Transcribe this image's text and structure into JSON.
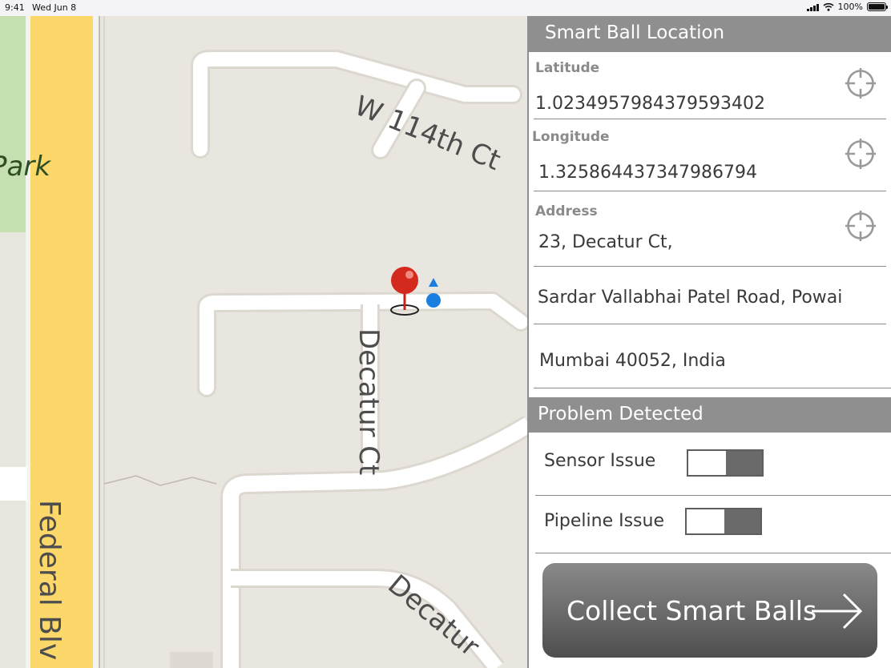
{
  "status_bar": {
    "time": "9:41",
    "date": "Wed Jun 8",
    "battery": "100%"
  },
  "map": {
    "labels": {
      "park": "Park",
      "w114": "W 114th Ct",
      "decatur_ct": "Decatur Ct",
      "decatur_lower": "Decatur",
      "federal": "Federal Blv"
    }
  },
  "location": {
    "header": "Smart Ball Location",
    "latitude_label": "Latitude",
    "latitude_value": "1.0234957984379593402",
    "longitude_label": "Longitude",
    "longitude_value": "1.325864437347986794",
    "address_label": "Address",
    "address_line1": "23, Decatur Ct,",
    "address_line2": "Sardar Vallabhai Patel Road, Powai",
    "address_line3": "Mumbai 40052, India"
  },
  "problem": {
    "header": "Problem Detected",
    "sensor_label": "Sensor Issue",
    "pipeline_label": "Pipeline Issue"
  },
  "collect_button": {
    "label": "Collect Smart Balls"
  },
  "colors": {
    "header_gray": "#8f8f8f",
    "pin_red": "#d42a1e",
    "user_blue": "#1a7fe0",
    "boulevard_yellow": "#fcd86a"
  }
}
